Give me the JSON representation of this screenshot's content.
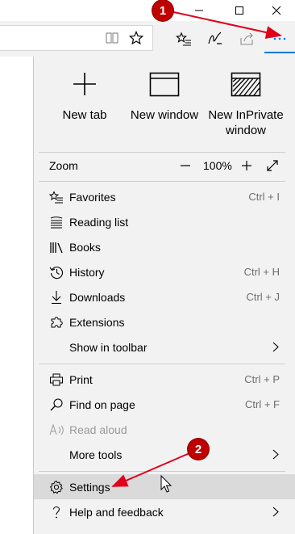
{
  "menu": {
    "new_items": [
      {
        "label": "New tab",
        "icon": "plus-icon"
      },
      {
        "label": "New window",
        "icon": "window-icon"
      },
      {
        "label": "New InPrivate window",
        "icon": "inprivate-window-icon"
      }
    ],
    "zoom": {
      "label": "Zoom",
      "value": "100%",
      "minus": "—",
      "plus": "+"
    },
    "items_group1": [
      {
        "label": "Favorites",
        "shortcut": "Ctrl + I",
        "icon": "favorites-icon"
      },
      {
        "label": "Reading list",
        "shortcut": "",
        "icon": "reading-list-icon"
      },
      {
        "label": "Books",
        "shortcut": "",
        "icon": "books-icon"
      },
      {
        "label": "History",
        "shortcut": "Ctrl + H",
        "icon": "history-icon"
      },
      {
        "label": "Downloads",
        "shortcut": "Ctrl + J",
        "icon": "download-icon"
      },
      {
        "label": "Extensions",
        "shortcut": "",
        "icon": "extensions-icon"
      },
      {
        "label": "Show in toolbar",
        "shortcut": "",
        "icon": "",
        "submenu": true
      }
    ],
    "items_group2": [
      {
        "label": "Print",
        "shortcut": "Ctrl + P",
        "icon": "print-icon"
      },
      {
        "label": "Find on page",
        "shortcut": "Ctrl + F",
        "icon": "search-icon"
      },
      {
        "label": "Read aloud",
        "shortcut": "",
        "icon": "read-aloud-icon",
        "disabled": true
      },
      {
        "label": "More tools",
        "shortcut": "",
        "icon": "",
        "submenu": true
      }
    ],
    "items_group3": [
      {
        "label": "Settings",
        "icon": "gear-icon",
        "highlighted": true
      },
      {
        "label": "Help and feedback",
        "icon": "help-icon",
        "submenu": true
      }
    ]
  },
  "annotations": [
    {
      "number": "1"
    },
    {
      "number": "2"
    }
  ],
  "colors": {
    "accent": "#0078d7",
    "menu_bg": "#f2f2f2",
    "highlight_bg": "#dadada",
    "annotation": "#c00000"
  }
}
